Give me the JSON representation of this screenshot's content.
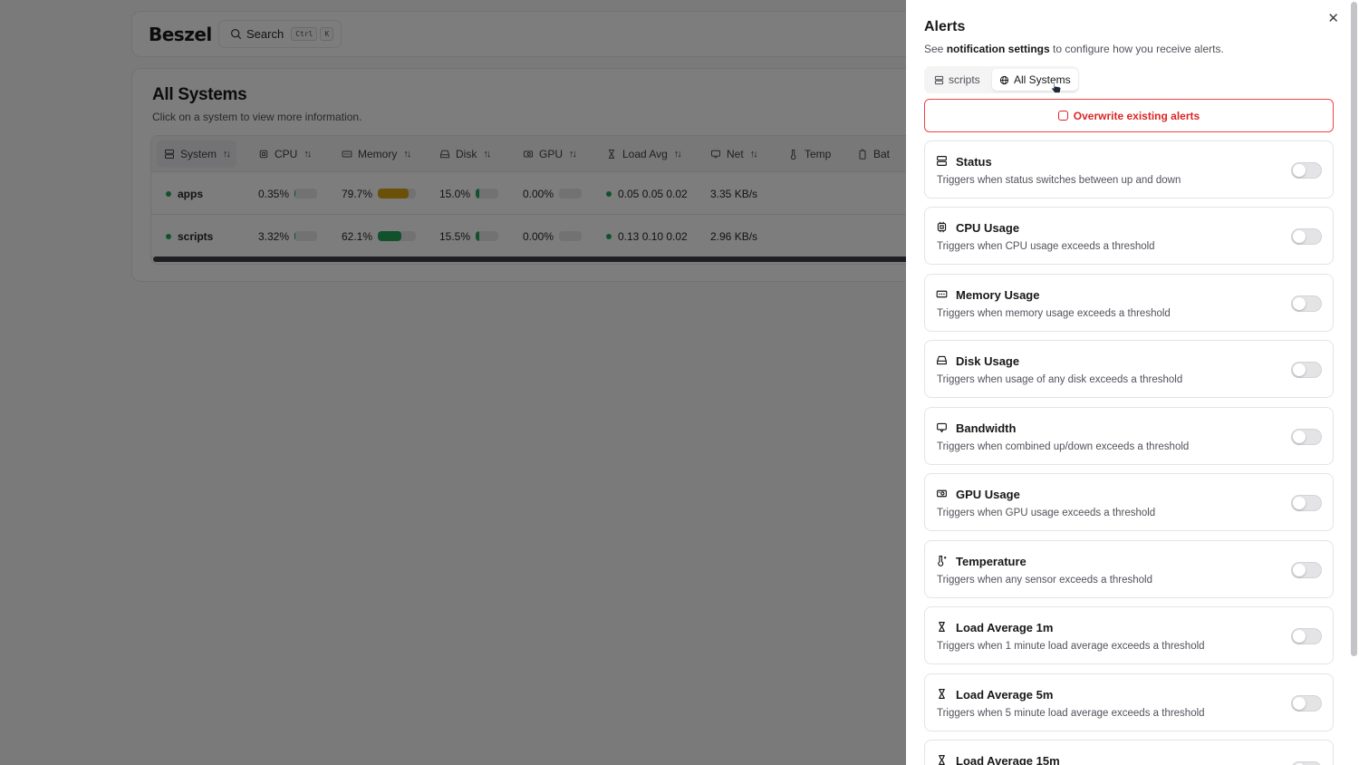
{
  "header": {
    "logo": "Beszel",
    "search_label": "Search",
    "shortcut_keys": [
      "Ctrl",
      "K"
    ]
  },
  "systems": {
    "title": "All Systems",
    "subtitle": "Click on a system to view more information.",
    "columns": [
      "System",
      "CPU",
      "Memory",
      "Disk",
      "GPU",
      "Load Avg",
      "Net",
      "Temp",
      "Bat"
    ],
    "rows": [
      {
        "name": "apps",
        "cpu": "0.35%",
        "cpu_pct": 0.35,
        "memory": "79.7%",
        "memory_pct": 79.7,
        "disk": "15.0%",
        "disk_pct": 15.0,
        "gpu": "0.00%",
        "gpu_pct": 0,
        "load": "0.05 0.05 0.02",
        "net": "3.35 KB/s"
      },
      {
        "name": "scripts",
        "cpu": "3.32%",
        "cpu_pct": 3.32,
        "memory": "62.1%",
        "memory_pct": 62.1,
        "disk": "15.5%",
        "disk_pct": 15.5,
        "gpu": "0.00%",
        "gpu_pct": 0,
        "load": "0.13 0.10 0.02",
        "net": "2.96 KB/s"
      }
    ]
  },
  "colors": {
    "status_up": "#22a55b",
    "memory_warn": "#d4a010",
    "memory_ok": "#22a55b",
    "danger": "#dc2626"
  },
  "alerts_panel": {
    "title": "Alerts",
    "subtitle_before": "See ",
    "subtitle_link": "notification settings",
    "subtitle_after": " to configure how you receive alerts.",
    "tabs": [
      {
        "label": "scripts",
        "icon": "server-icon",
        "active": false
      },
      {
        "label": "All Systems",
        "icon": "globe-icon",
        "active": true
      }
    ],
    "overwrite_label": "Overwrite existing alerts",
    "alerts": [
      {
        "name": "Status",
        "description": "Triggers when status switches between up and down",
        "icon": "server-icon",
        "enabled": false
      },
      {
        "name": "CPU Usage",
        "description": "Triggers when CPU usage exceeds a threshold",
        "icon": "cpu-icon",
        "enabled": false
      },
      {
        "name": "Memory Usage",
        "description": "Triggers when memory usage exceeds a threshold",
        "icon": "memory-icon",
        "enabled": false
      },
      {
        "name": "Disk Usage",
        "description": "Triggers when usage of any disk exceeds a threshold",
        "icon": "disk-icon",
        "enabled": false
      },
      {
        "name": "Bandwidth",
        "description": "Triggers when combined up/down exceeds a threshold",
        "icon": "network-icon",
        "enabled": false
      },
      {
        "name": "GPU Usage",
        "description": "Triggers when GPU usage exceeds a threshold",
        "icon": "gpu-icon",
        "enabled": false
      },
      {
        "name": "Temperature",
        "description": "Triggers when any sensor exceeds a threshold",
        "icon": "thermometer-icon",
        "enabled": false
      },
      {
        "name": "Load Average 1m",
        "description": "Triggers when 1 minute load average exceeds a threshold",
        "icon": "hourglass-icon",
        "enabled": false
      },
      {
        "name": "Load Average 5m",
        "description": "Triggers when 5 minute load average exceeds a threshold",
        "icon": "hourglass-icon",
        "enabled": false
      },
      {
        "name": "Load Average 15m",
        "description": "",
        "icon": "hourglass-icon",
        "enabled": false
      }
    ]
  }
}
